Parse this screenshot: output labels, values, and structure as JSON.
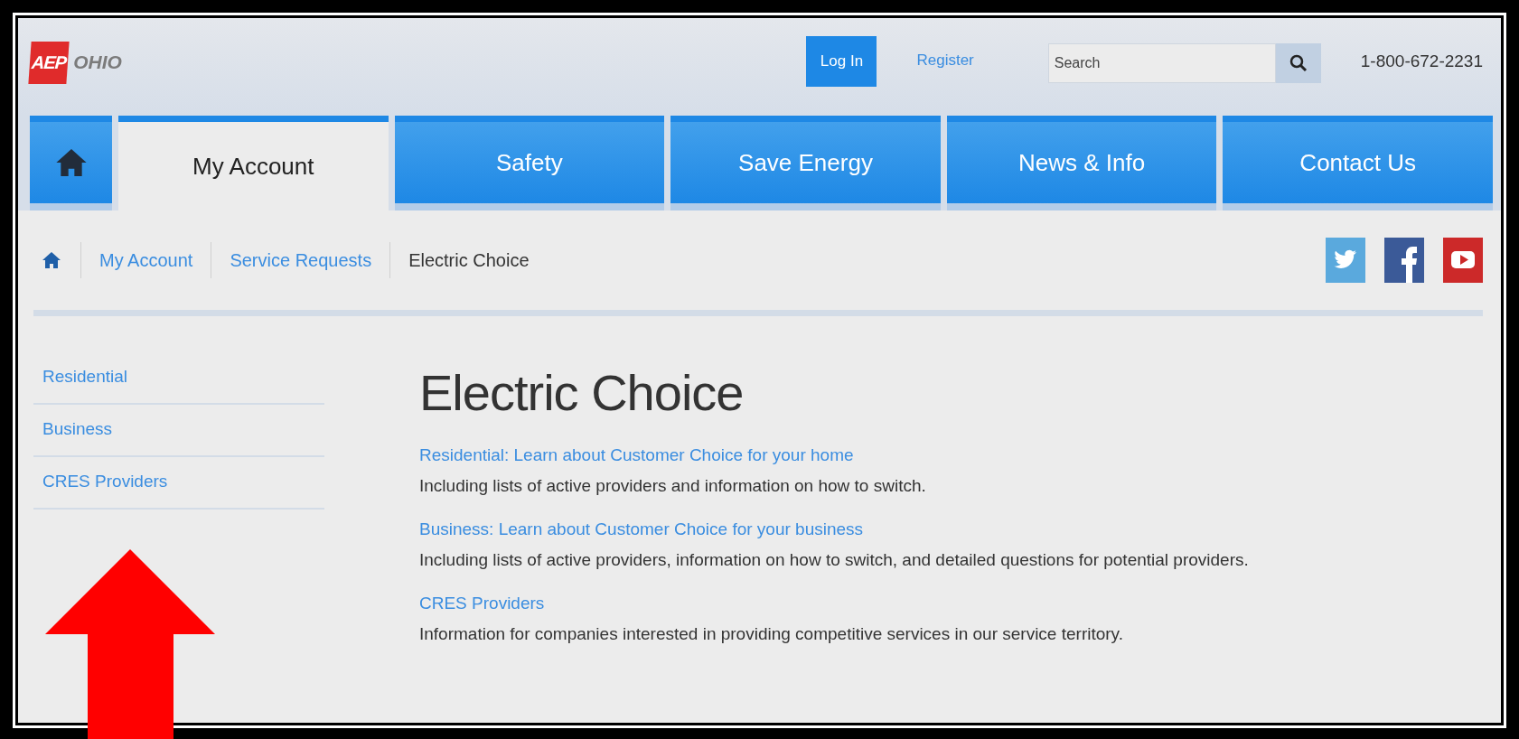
{
  "header": {
    "logo": {
      "mark": "AEP",
      "name": "OHIO"
    },
    "login": "Log In",
    "register": "Register",
    "search": {
      "placeholder": "Search"
    },
    "phone": "1-800-672-2231"
  },
  "nav": [
    {
      "kind": "home",
      "selected": false
    },
    {
      "kind": "text",
      "label": "My Account",
      "selected": true
    },
    {
      "kind": "text",
      "label": "Safety",
      "selected": false
    },
    {
      "kind": "text",
      "label": "Save Energy",
      "selected": false
    },
    {
      "kind": "text",
      "label": "News & Info",
      "selected": false
    },
    {
      "kind": "text",
      "label": "Contact Us",
      "selected": false
    }
  ],
  "breadcrumb": [
    {
      "kind": "home"
    },
    {
      "kind": "link",
      "label": "My Account"
    },
    {
      "kind": "link",
      "label": "Service Requests"
    },
    {
      "kind": "current",
      "label": "Electric Choice"
    }
  ],
  "social": [
    {
      "kind": "twitter"
    },
    {
      "kind": "facebook"
    },
    {
      "kind": "youtube"
    }
  ],
  "sidebar": {
    "items": [
      {
        "label": "Residential"
      },
      {
        "label": "Business"
      },
      {
        "label": "CRES Providers"
      }
    ]
  },
  "main": {
    "title": "Electric Choice",
    "sections": [
      {
        "link": "Residential: Learn about Customer Choice for your home",
        "text": "Including lists of active providers and information on how to switch."
      },
      {
        "link": "Business: Learn about Customer Choice for your business",
        "text": "Including lists of active providers, information on how to switch, and detailed questions for potential providers."
      },
      {
        "link": "CRES Providers",
        "text": "Information for companies interested in providing competitive services in our service territory."
      }
    ]
  },
  "annotation": {
    "kind": "arrow"
  }
}
